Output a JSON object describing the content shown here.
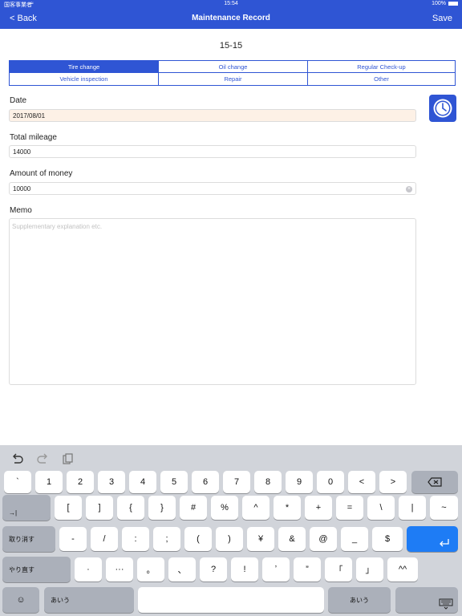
{
  "status": {
    "carrier": "国客事業者",
    "time": "15:54",
    "battery": "100%"
  },
  "nav": {
    "back": "< Back",
    "title": "Maintenance Record",
    "save": "Save"
  },
  "record_id": "15-15",
  "categories": [
    "Tire change",
    "Oil change",
    "Regular Check-up",
    "Vehicle inspection",
    "Repair",
    "Other"
  ],
  "selected_category": "Tire change",
  "form": {
    "date_label": "Date",
    "date_value": "2017/08/01",
    "mileage_label": "Total mileage",
    "mileage_value": "14000",
    "money_label": "Amount of money",
    "money_value": "10000",
    "memo_label": "Memo",
    "memo_placeholder": "Supplementary explanation etc."
  },
  "keyboard": {
    "row1": [
      "`",
      "1",
      "2",
      "3",
      "4",
      "5",
      "6",
      "7",
      "8",
      "9",
      "0",
      "<",
      ">"
    ],
    "row2": [
      "[",
      "]",
      "{",
      "}",
      "#",
      "%",
      "^",
      "*",
      "+",
      "=",
      "\\",
      "|",
      "~"
    ],
    "row3": [
      "-",
      "/",
      ":",
      ";",
      "(",
      ")",
      "¥",
      "&",
      "@",
      "_",
      "$"
    ],
    "row4": [
      "·",
      "···",
      "。",
      "、",
      "?",
      "!",
      "ʼ",
      "”",
      "「",
      "」",
      "^^"
    ],
    "tab_label": "→|",
    "undo_label": "取り消す",
    "redo_label": "やり直す",
    "kana_label": "あいう",
    "emoji_label": "☺"
  },
  "colors": {
    "accent": "#2f55d4",
    "return_key": "#1e7cf5",
    "date_bg": "#fdf1e6"
  }
}
